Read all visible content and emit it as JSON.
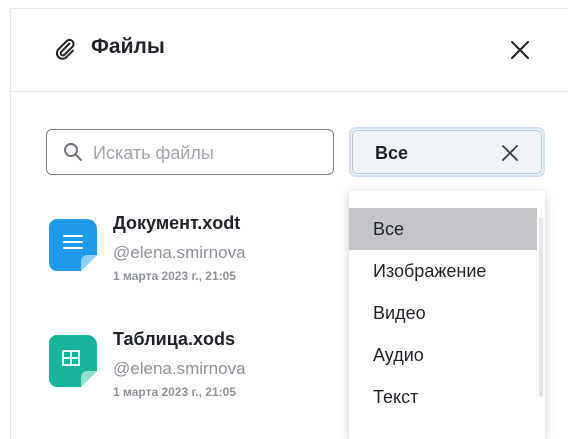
{
  "header": {
    "title": "Файлы",
    "icon": "paperclip-icon",
    "close_icon": "close-icon"
  },
  "search": {
    "placeholder": "Искать файлы",
    "value": "",
    "icon": "search-icon"
  },
  "filter": {
    "selected": "Все",
    "clear_icon": "clear-icon",
    "accent": "#cfe0f7"
  },
  "files": [
    {
      "name": "Документ.xodt",
      "author": "@elena.smirnova",
      "date": "1 марта 2023 г., 21:05",
      "icon": "document-file-icon",
      "color": "#1e9be8"
    },
    {
      "name": "Таблица.xods",
      "author": "@elena.smirnova",
      "date": "1 марта 2023 г., 21:05",
      "icon": "spreadsheet-file-icon",
      "color": "#17b59a"
    }
  ],
  "dropdown": {
    "options": [
      "Все",
      "Изображение",
      "Видео",
      "Аудио",
      "Текст"
    ],
    "selected_index": 0
  }
}
